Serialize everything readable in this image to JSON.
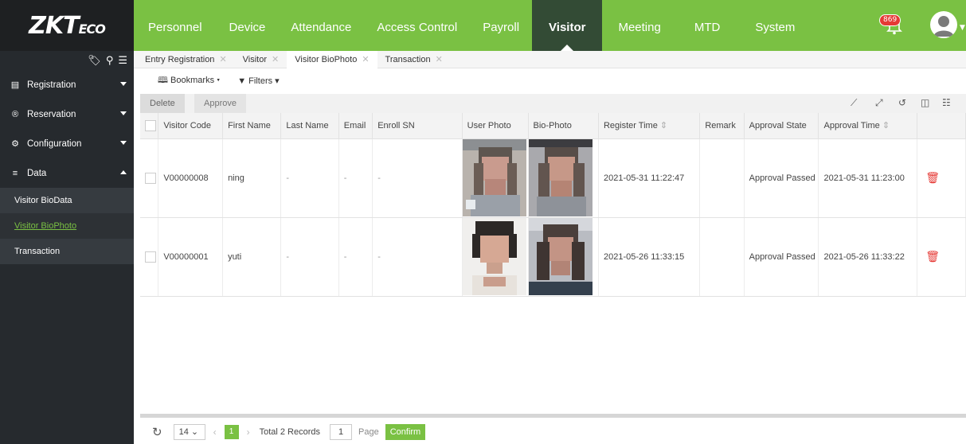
{
  "logo": {
    "main": "ZKT",
    "suffix": "ECO"
  },
  "nav": [
    "Personnel",
    "Device",
    "Attendance",
    "Access Control",
    "Payroll",
    "Visitor",
    "Meeting",
    "MTD",
    "System"
  ],
  "nav_active": "Visitor",
  "notifications": {
    "count": "869"
  },
  "sidebar": {
    "groups": [
      {
        "label": "Registration",
        "icon": "id-card-icon",
        "expanded": false
      },
      {
        "label": "Reservation",
        "icon": "registered-icon",
        "expanded": false
      },
      {
        "label": "Configuration",
        "icon": "gears-icon",
        "expanded": false
      },
      {
        "label": "Data",
        "icon": "database-icon",
        "expanded": true
      }
    ],
    "subitems": [
      "Visitor BioData",
      "Visitor BioPhoto",
      "Transaction"
    ],
    "active_subitem": "Visitor BioPhoto"
  },
  "tabs": [
    "Entry Registration",
    "Visitor",
    "Visitor BioPhoto",
    "Transaction"
  ],
  "active_tab": "Visitor BioPhoto",
  "filterbar": {
    "bookmarks": "Bookmarks",
    "filters": "Filters"
  },
  "ops": {
    "delete": "Delete",
    "approve": "Approve"
  },
  "table": {
    "headers": [
      "Visitor Code",
      "First Name",
      "Last Name",
      "Email",
      "Enroll SN",
      "User Photo",
      "Bio-Photo",
      "Register Time",
      "Remark",
      "Approval State",
      "Approval Time"
    ],
    "rows": [
      {
        "code": "V00000008",
        "first": "ning",
        "last": "-",
        "email": "-",
        "sn": "-",
        "register": "2021-05-31 11:22:47",
        "remark": "",
        "state": "Approval Passed",
        "approval": "2021-05-31 11:23:00"
      },
      {
        "code": "V00000001",
        "first": "yuti",
        "last": "-",
        "email": "-",
        "sn": "-",
        "register": "2021-05-26 11:33:15",
        "remark": "",
        "state": "Approval Passed",
        "approval": "2021-05-26 11:33:22"
      }
    ]
  },
  "pager": {
    "size": "14",
    "page": "1",
    "total": "Total 2 Records",
    "goto": "1",
    "page_label": "Page",
    "confirm": "Confirm"
  },
  "colors": {
    "brand": "#7ac143",
    "dark": "#262a2e",
    "danger": "#e53935"
  }
}
